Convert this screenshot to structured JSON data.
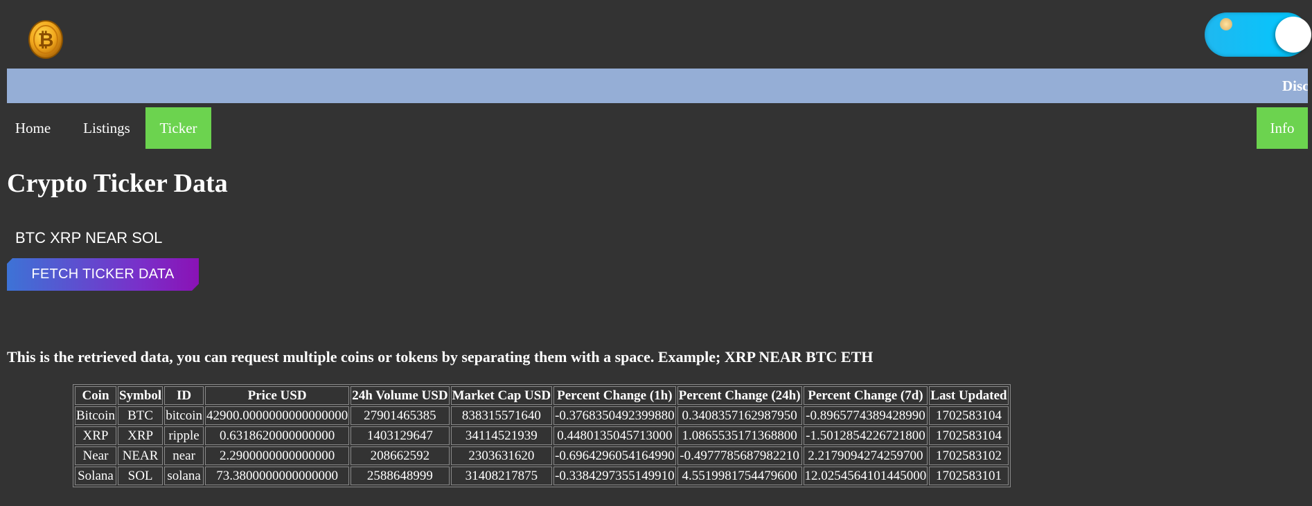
{
  "header": {
    "logo_icon": "bitcoin-logo-icon",
    "toggle_icon": "theme-toggle-icon"
  },
  "marquee": {
    "text": "Disc"
  },
  "nav": {
    "home": "Home",
    "listings": "Listings",
    "ticker": "Ticker",
    "info": "Info",
    "active": "Ticker"
  },
  "main": {
    "title": "Crypto Ticker Data",
    "input_value": "BTC XRP NEAR SOL",
    "fetch_button": "FETCH TICKER DATA",
    "info_text": "This is the retrieved data, you can request multiple coins or tokens by separating them with a space. Example; XRP NEAR BTC ETH"
  },
  "table": {
    "headers": [
      "Coin",
      "Symbol",
      "ID",
      "Price USD",
      "24h Volume USD",
      "Market Cap USD",
      "Percent Change (1h)",
      "Percent Change (24h)",
      "Percent Change (7d)",
      "Last Updated"
    ],
    "rows": [
      [
        "Bitcoin",
        "BTC",
        "bitcoin",
        "42900.0000000000000000",
        "27901465385",
        "838315571640",
        "-0.3768350492399880",
        "0.3408357162987950",
        "-0.8965774389428990",
        "1702583104"
      ],
      [
        "XRP",
        "XRP",
        "ripple",
        "0.6318620000000000",
        "1403129647",
        "34114521939",
        "0.4480135045713000",
        "1.0865535171368800",
        "-1.5012854226721800",
        "1702583104"
      ],
      [
        "Near",
        "NEAR",
        "near",
        "2.2900000000000000",
        "208662592",
        "2303631620",
        "-0.6964296054164990",
        "-0.4977785687982210",
        "2.2179094274259700",
        "1702583102"
      ],
      [
        "Solana",
        "SOL",
        "solana",
        "73.3800000000000000",
        "2588648999",
        "31408217875",
        "-0.3384297355149910",
        "4.5519981754479600",
        "12.0254564101445000",
        "1702583101"
      ]
    ]
  },
  "colors": {
    "background": "#333333",
    "marquee": "#95aed6",
    "nav_active": "#6cd34f",
    "toggle": "#00c8ff"
  }
}
